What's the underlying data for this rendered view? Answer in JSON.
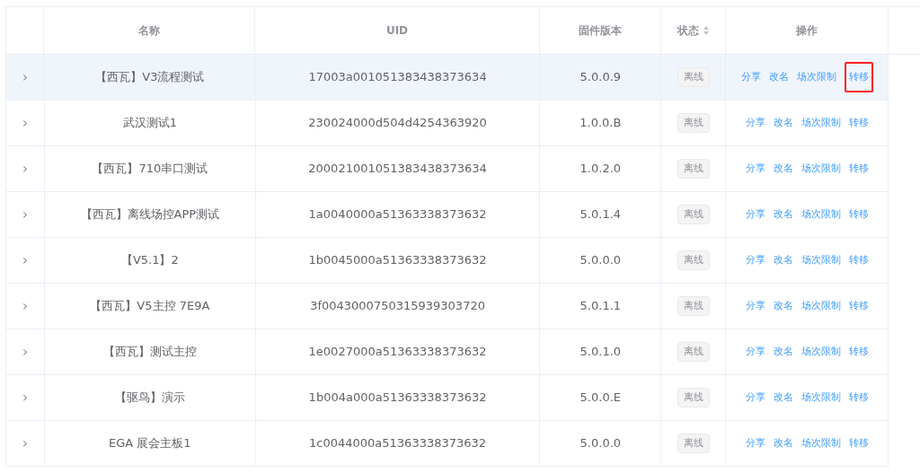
{
  "columns": [
    {
      "label": "名称",
      "sortable": false
    },
    {
      "label": "UID",
      "sortable": false
    },
    {
      "label": "固件版本",
      "sortable": false
    },
    {
      "label": "状态",
      "sortable": true
    },
    {
      "label": "操作",
      "sortable": false
    }
  ],
  "rows": [
    {
      "expand": "›",
      "name": "【西瓦】V3流程测试",
      "uid": "17003a001051383438373634",
      "firmware": "5.0.0.9",
      "status": "离线",
      "selected": true,
      "actions": [
        {
          "label": "分享",
          "marked": false
        },
        {
          "label": "改名",
          "marked": false
        },
        {
          "label": "场次限制",
          "marked": false
        },
        {
          "label": "转移",
          "marked": true
        }
      ]
    },
    {
      "expand": "›",
      "name": "武汉测试1",
      "uid": "230024000d504d4254363920",
      "firmware": "1.0.0.B",
      "status": "离线",
      "selected": false,
      "actions": [
        {
          "label": "分享",
          "marked": false
        },
        {
          "label": "改名",
          "marked": false
        },
        {
          "label": "场次限制",
          "marked": false
        },
        {
          "label": "转移",
          "marked": false
        }
      ]
    },
    {
      "expand": "›",
      "name": "【西瓦】710串口测试",
      "uid": "200021001051383438373634",
      "firmware": "1.0.2.0",
      "status": "离线",
      "selected": false,
      "actions": [
        {
          "label": "分享",
          "marked": false
        },
        {
          "label": "改名",
          "marked": false
        },
        {
          "label": "场次限制",
          "marked": false
        },
        {
          "label": "转移",
          "marked": false
        }
      ]
    },
    {
      "expand": "›",
      "name": "【西瓦】离线场控APP测试",
      "uid": "1a0040000a51363338373632",
      "firmware": "5.0.1.4",
      "status": "离线",
      "selected": false,
      "actions": [
        {
          "label": "分享",
          "marked": false
        },
        {
          "label": "改名",
          "marked": false
        },
        {
          "label": "场次限制",
          "marked": false
        },
        {
          "label": "转移",
          "marked": false
        }
      ]
    },
    {
      "expand": "›",
      "name": "【V5.1】2",
      "uid": "1b0045000a51363338373632",
      "firmware": "5.0.0.0",
      "status": "离线",
      "selected": false,
      "actions": [
        {
          "label": "分享",
          "marked": false
        },
        {
          "label": "改名",
          "marked": false
        },
        {
          "label": "场次限制",
          "marked": false
        },
        {
          "label": "转移",
          "marked": false
        }
      ]
    },
    {
      "expand": "›",
      "name": "【西瓦】V5主控 7E9A",
      "uid": "3f0043000750315939303720",
      "firmware": "5.0.1.1",
      "status": "离线",
      "selected": false,
      "actions": [
        {
          "label": "分享",
          "marked": false
        },
        {
          "label": "改名",
          "marked": false
        },
        {
          "label": "场次限制",
          "marked": false
        },
        {
          "label": "转移",
          "marked": false
        }
      ]
    },
    {
      "expand": "›",
      "name": "【西瓦】测试主控",
      "uid": "1e0027000a51363338373632",
      "firmware": "5.0.1.0",
      "status": "离线",
      "selected": false,
      "actions": [
        {
          "label": "分享",
          "marked": false
        },
        {
          "label": "改名",
          "marked": false
        },
        {
          "label": "场次限制",
          "marked": false
        },
        {
          "label": "转移",
          "marked": false
        }
      ]
    },
    {
      "expand": "›",
      "name": "【驱鸟】演示",
      "uid": "1b004a000a51363338373632",
      "firmware": "5.0.0.E",
      "status": "离线",
      "selected": false,
      "actions": [
        {
          "label": "分享",
          "marked": false
        },
        {
          "label": "改名",
          "marked": false
        },
        {
          "label": "场次限制",
          "marked": false
        },
        {
          "label": "转移",
          "marked": false
        }
      ]
    },
    {
      "expand": "›",
      "name": "EGA 展会主板1",
      "uid": "1c0044000a51363338373632",
      "firmware": "5.0.0.0",
      "status": "离线",
      "selected": false,
      "actions": [
        {
          "label": "分享",
          "marked": false
        },
        {
          "label": "改名",
          "marked": false
        },
        {
          "label": "场次限制",
          "marked": false
        },
        {
          "label": "转移",
          "marked": false
        }
      ]
    }
  ]
}
